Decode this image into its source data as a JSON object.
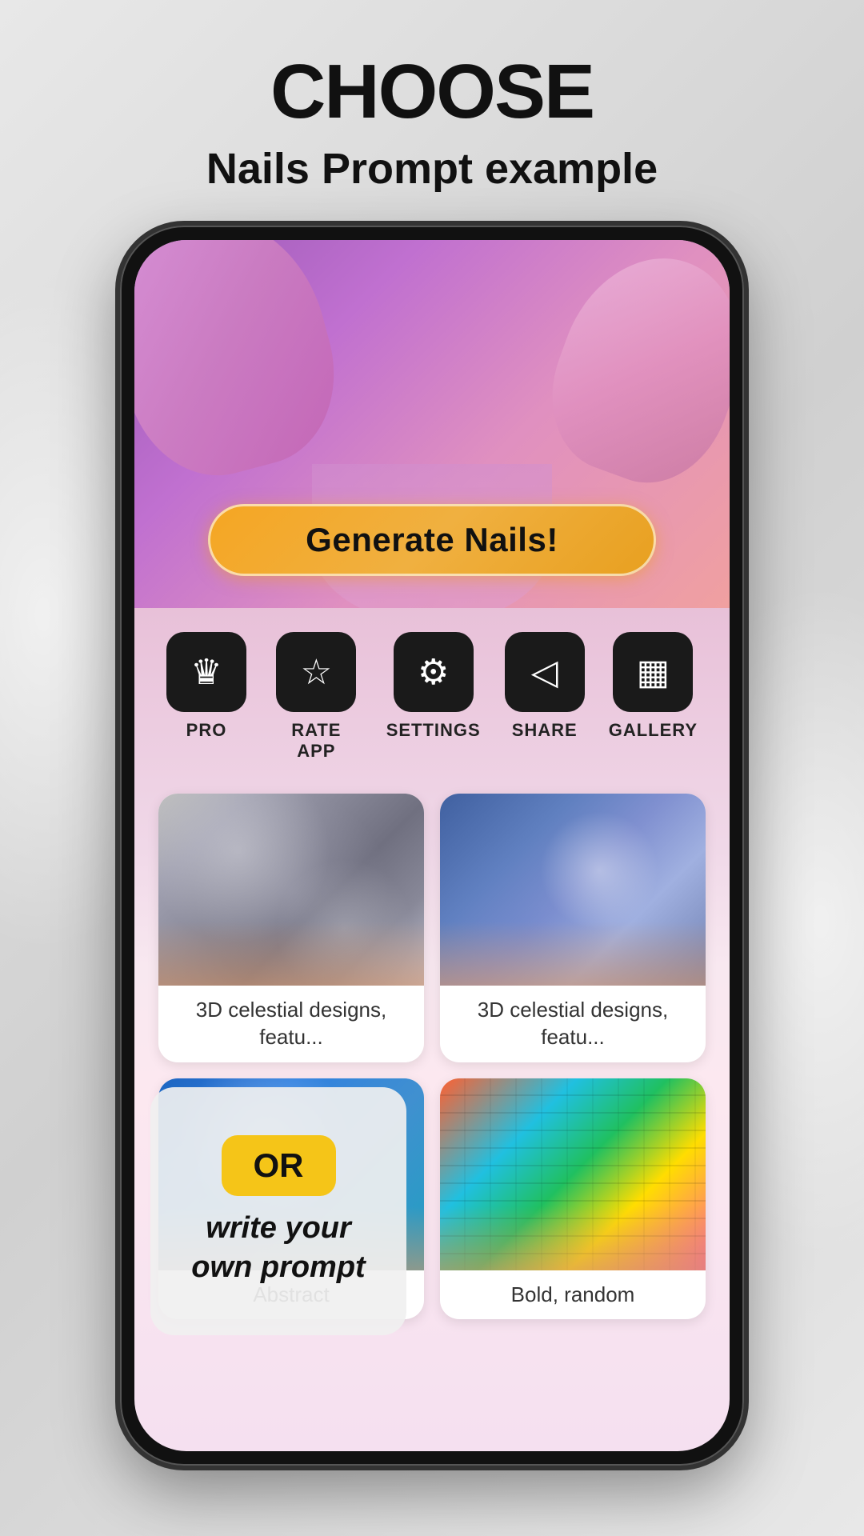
{
  "page": {
    "title": "CHOOSE",
    "subtitle": "Nails Prompt example"
  },
  "generate_button": {
    "label": "Generate Nails!"
  },
  "action_buttons": [
    {
      "id": "pro",
      "icon": "♛",
      "label": "PRO"
    },
    {
      "id": "rate",
      "icon": "☆",
      "label": "RATE APP"
    },
    {
      "id": "settings",
      "icon": "⚙",
      "label": "SETTINGS"
    },
    {
      "id": "share",
      "icon": "◁",
      "label": "SHARE"
    },
    {
      "id": "gallery",
      "icon": "▦",
      "label": "GALLERY"
    }
  ],
  "nail_cards": [
    {
      "id": "card1",
      "img_class": "nail-img-1",
      "caption": "3D celestial designs, featu..."
    },
    {
      "id": "card2",
      "img_class": "nail-img-2",
      "caption": "3D celestial designs, featu..."
    },
    {
      "id": "card3",
      "img_class": "nail-img-3",
      "caption": "Abstract"
    },
    {
      "id": "card4",
      "img_class": "nail-img-4",
      "caption": "Bold, random"
    }
  ],
  "or_card": {
    "badge": "OR",
    "text": "write your own prompt"
  }
}
